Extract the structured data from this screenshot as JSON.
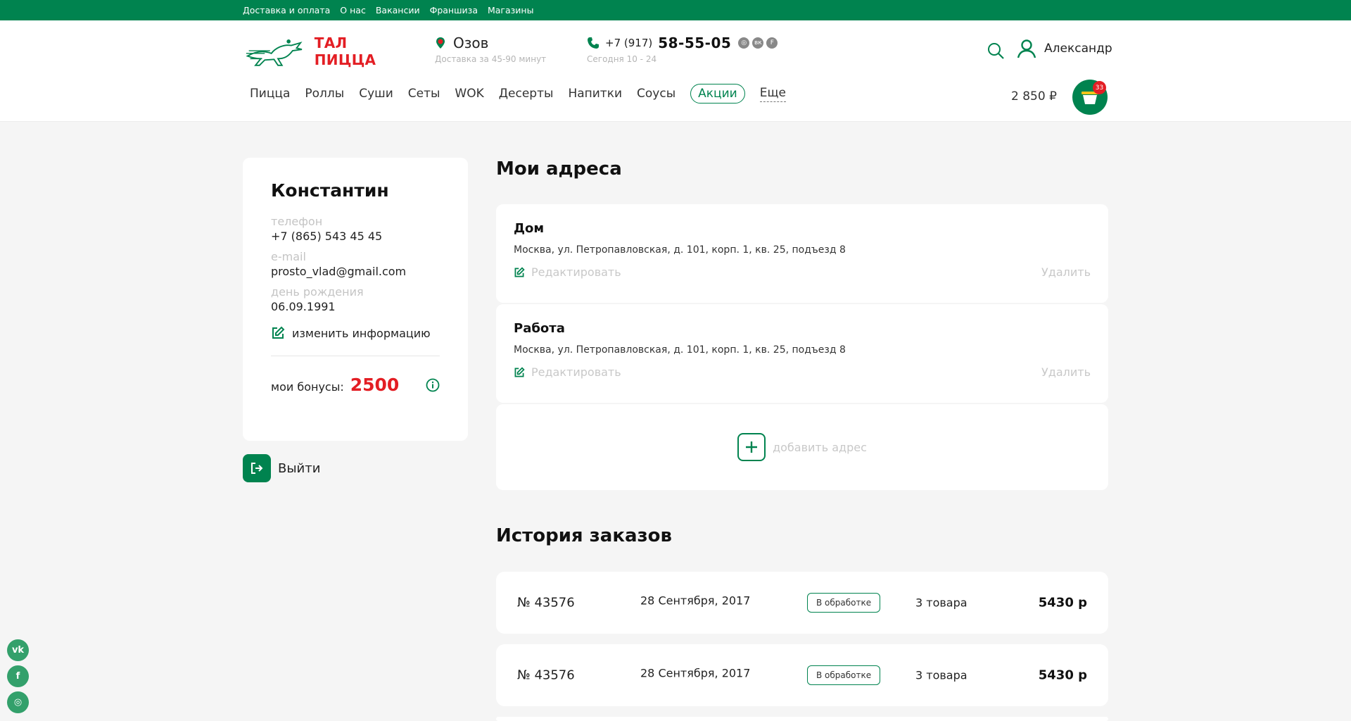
{
  "topbar": {
    "links": [
      "Доставка и оплата",
      "О нас",
      "Вакансии",
      "Франшиза",
      "Магазины"
    ]
  },
  "header": {
    "logo_text": "ТАЛ ПИЦЦА",
    "city": "Озов",
    "delivery_time": "Доставка за 45-90 минут",
    "phone_code": "+7 (917)",
    "phone_number": "58-55-05",
    "hours": "Сегодня 10 - 24",
    "user_name": "Александр",
    "cart_total": "2 850 ₽",
    "cart_count": "33"
  },
  "nav": {
    "items": [
      "Пицца",
      "Роллы",
      "Суши",
      "Сеты",
      "WOK",
      "Десерты",
      "Напитки",
      "Соусы"
    ],
    "promo": "Акции",
    "more": "Еще"
  },
  "profile": {
    "name": "Константин",
    "phone_label": "телефон",
    "phone": "+7 (865) 543 45 45",
    "email_label": "e-mail",
    "email": "prosto_vlad@gmail.com",
    "birthday_label": "день рождения",
    "birthday": "06.09.1991",
    "edit_label": "изменить информацию",
    "bonus_label": "мои бонусы:",
    "bonus_value": "2500",
    "logout_label": "Выйти"
  },
  "addresses": {
    "title": "Мои адреса",
    "items": [
      {
        "name": "Дом",
        "address": "Москва, ул. Петропавловская, д. 101, корп. 1, кв. 25, подъезд 8"
      },
      {
        "name": "Работа",
        "address": "Москва, ул. Петропавловская, д. 101, корп. 1, кв. 25, подъезд 8"
      }
    ],
    "edit_label": "Редактировать",
    "delete_label": "Удалить",
    "add_label": "добавить адрес"
  },
  "orders": {
    "title": "История заказов",
    "items": [
      {
        "number": "№ 43576",
        "date": "28 Сентября, 2017",
        "status": "В обработке",
        "qty": "3 товара",
        "sum": "5430 р"
      },
      {
        "number": "№ 43576",
        "date": "28 Сентября, 2017",
        "status": "В обработке",
        "qty": "3 товара",
        "sum": "5430 р"
      }
    ]
  },
  "colors": {
    "brand_green": "#00834f",
    "accent_red": "#e31e24"
  }
}
